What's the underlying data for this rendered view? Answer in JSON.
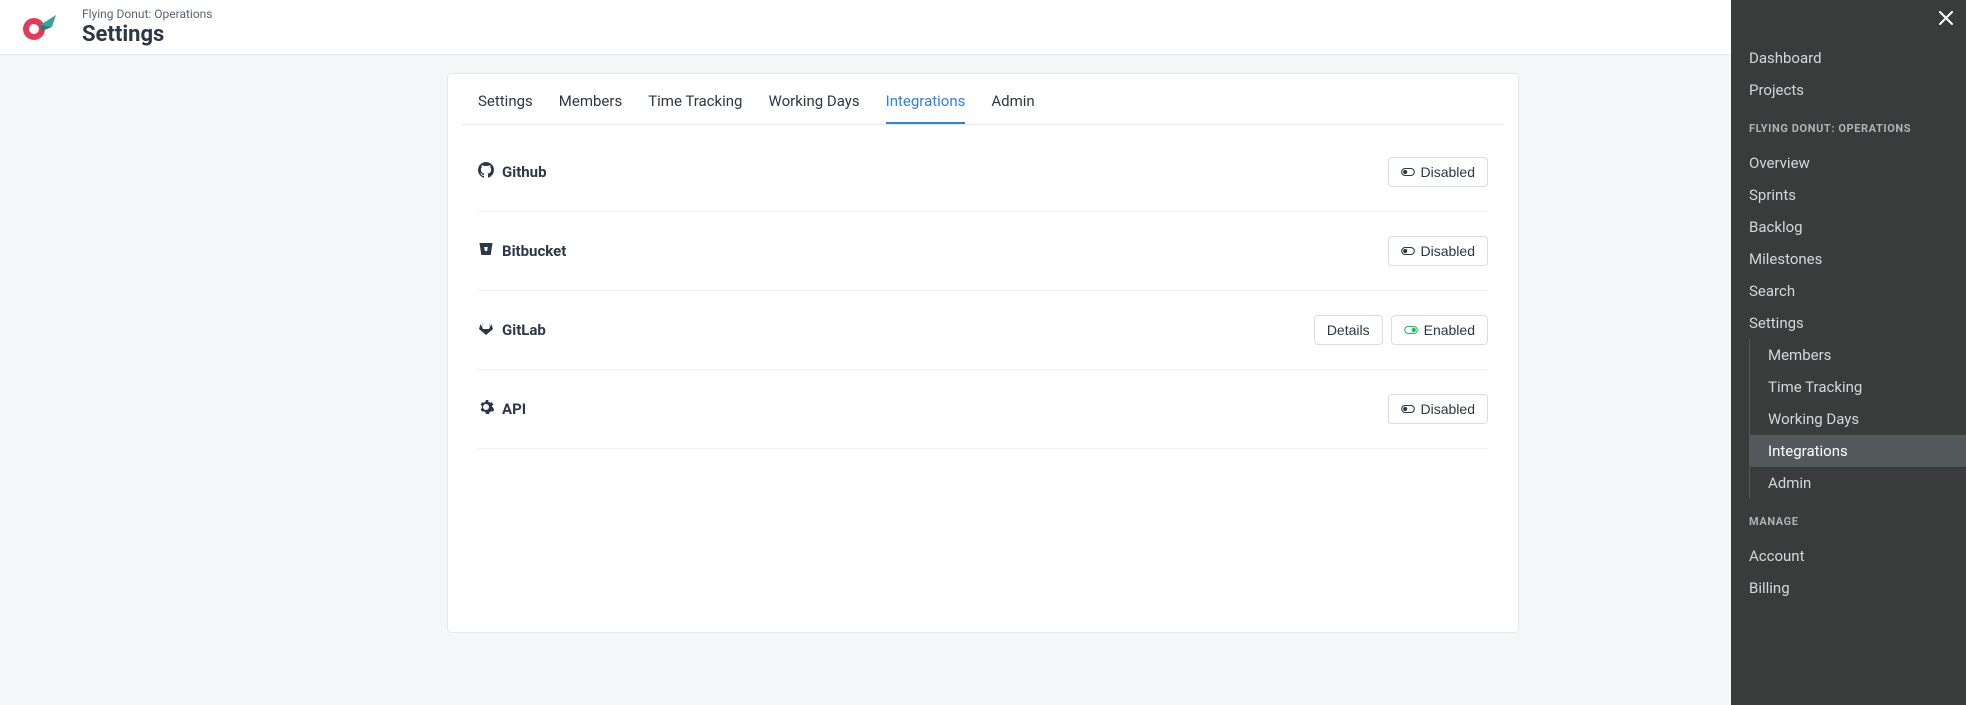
{
  "header": {
    "breadcrumb": "Flying Donut: Operations",
    "title": "Settings"
  },
  "tabs": [
    {
      "label": "Settings",
      "active": false
    },
    {
      "label": "Members",
      "active": false
    },
    {
      "label": "Time Tracking",
      "active": false
    },
    {
      "label": "Working Days",
      "active": false
    },
    {
      "label": "Integrations",
      "active": true
    },
    {
      "label": "Admin",
      "active": false
    }
  ],
  "integrations": [
    {
      "name": "Github",
      "status_label": "Disabled",
      "enabled": false,
      "details": false
    },
    {
      "name": "Bitbucket",
      "status_label": "Disabled",
      "enabled": false,
      "details": false
    },
    {
      "name": "GitLab",
      "status_label": "Enabled",
      "enabled": true,
      "details": true,
      "details_label": "Details"
    },
    {
      "name": "API",
      "status_label": "Disabled",
      "enabled": false,
      "details": false
    }
  ],
  "sidebar": {
    "top": [
      "Dashboard",
      "Projects"
    ],
    "project_heading": "FLYING DONUT: OPERATIONS",
    "project_items": [
      "Overview",
      "Sprints",
      "Backlog",
      "Milestones",
      "Search",
      "Settings"
    ],
    "settings_sub": [
      {
        "label": "Members",
        "active": false
      },
      {
        "label": "Time Tracking",
        "active": false
      },
      {
        "label": "Working Days",
        "active": false
      },
      {
        "label": "Integrations",
        "active": true
      },
      {
        "label": "Admin",
        "active": false
      }
    ],
    "manage_heading": "MANAGE",
    "manage_items": [
      "Account",
      "Billing"
    ]
  }
}
